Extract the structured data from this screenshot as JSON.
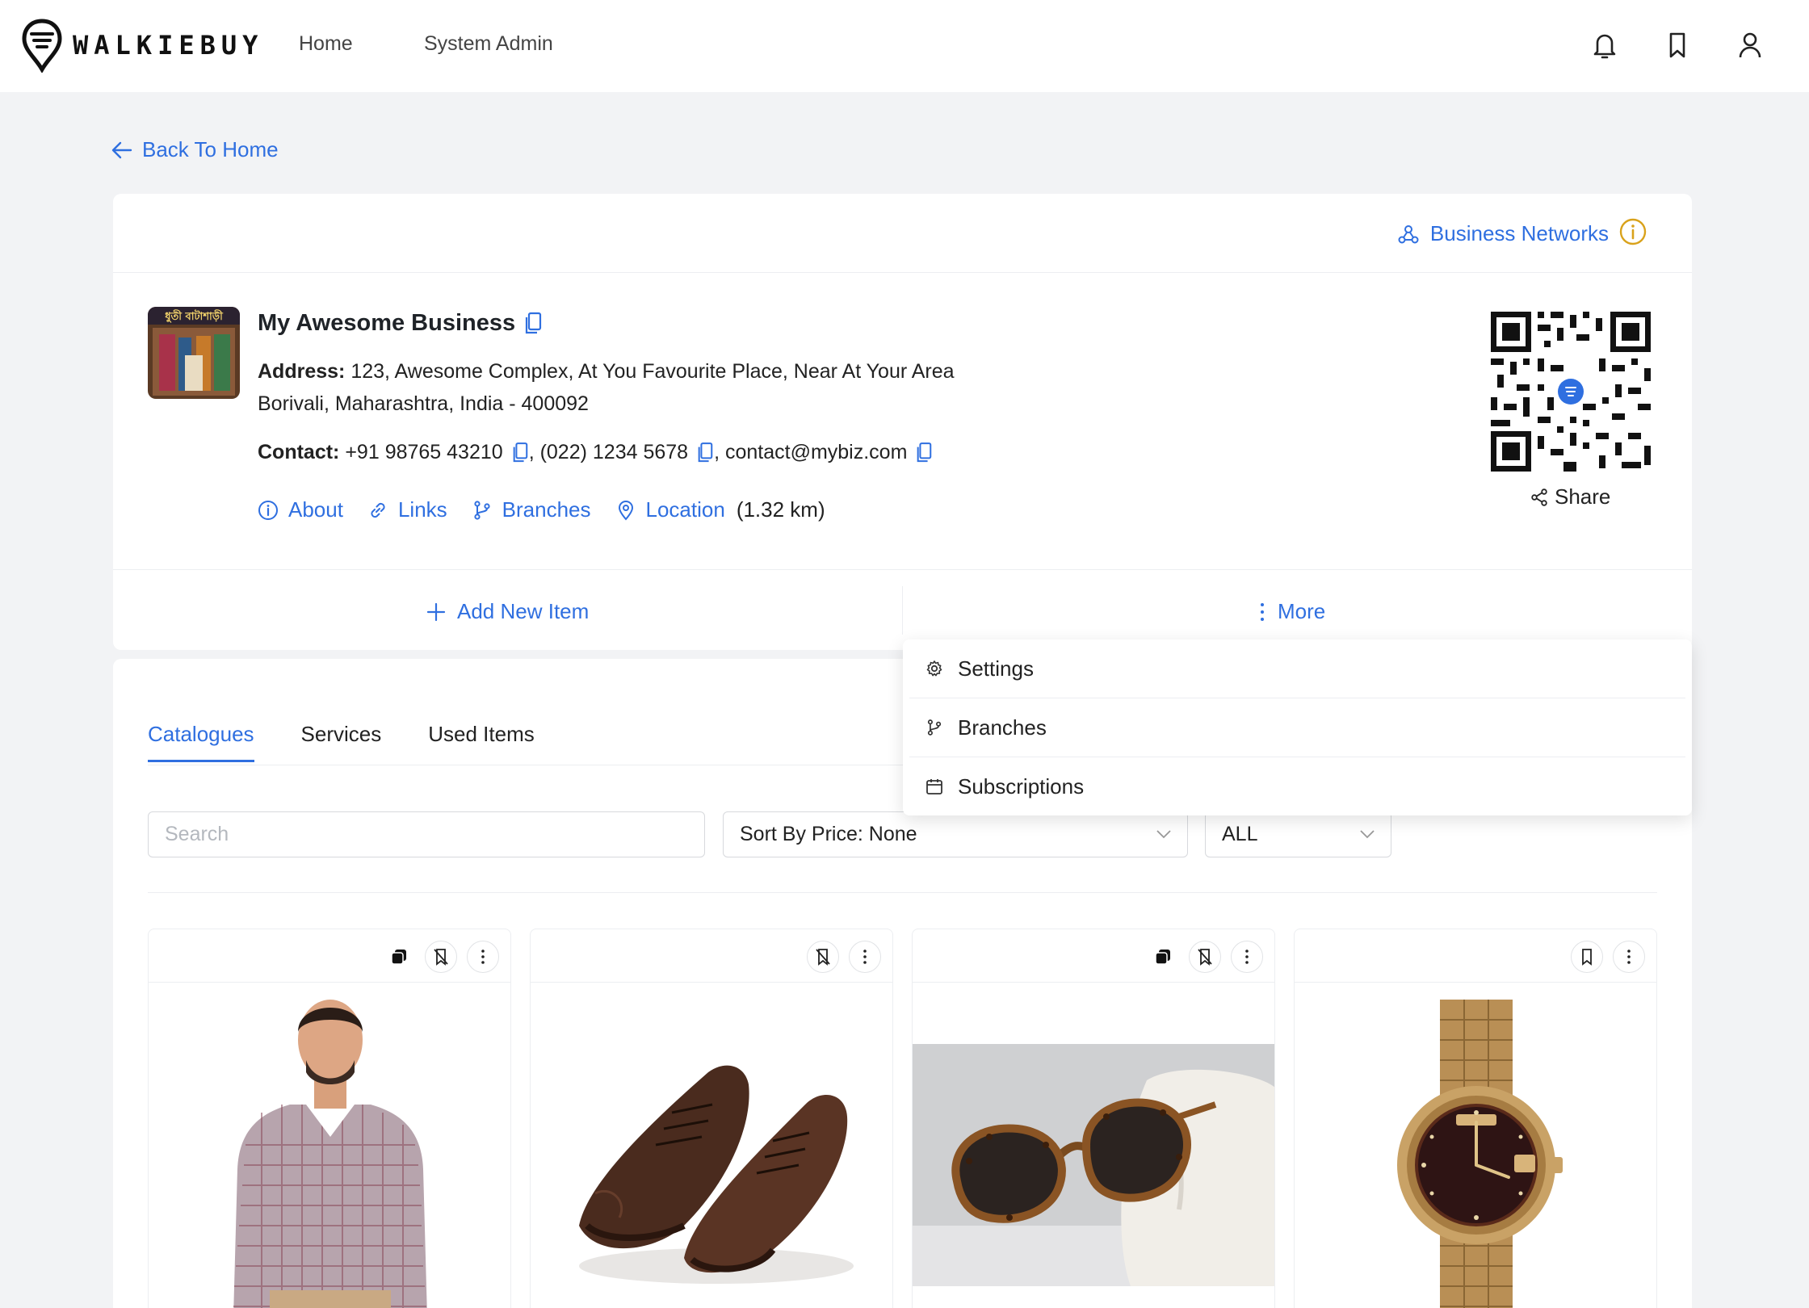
{
  "brand": {
    "name": "WALKIEBUY"
  },
  "nav": {
    "home": "Home",
    "system_admin": "System Admin"
  },
  "top_icons": [
    "bell-icon",
    "bookmark-icon",
    "user-icon"
  ],
  "back_link": "Back To Home",
  "business": {
    "networks_link": "Business Networks",
    "name": "My Awesome Business",
    "address_label": "Address:",
    "address_line1": " 123, Awesome Complex, At You Favourite Place, Near At Your Area",
    "address_line2": "Borivali, Maharashtra, India - 400092",
    "contact_label": "Contact:",
    "phone1": " +91 98765 43210",
    "phone2": ", (022) 1234 5678",
    "email": ", contact@mybiz.com",
    "links": {
      "about": "About",
      "links": "Links",
      "branches": "Branches",
      "location": "Location",
      "distance": "(1.32 km)"
    },
    "share": "Share"
  },
  "actions": {
    "add_item": "Add New Item",
    "more": "More"
  },
  "more_menu": {
    "items": [
      {
        "label": "Settings",
        "icon": "gear-icon"
      },
      {
        "label": "Branches",
        "icon": "branch-icon"
      },
      {
        "label": "Subscriptions",
        "icon": "calendar-icon"
      }
    ]
  },
  "tabs": [
    "Catalogues",
    "Services",
    "Used Items"
  ],
  "active_tab": "Catalogues",
  "filters": {
    "search_placeholder": "Search",
    "sort": "Sort By Price: None",
    "category": "ALL"
  },
  "products": [
    {
      "image": "man-in-checked-shirt",
      "buttons": [
        "copy-icon",
        "bookmark-off-icon",
        "kebab-menu-icon"
      ]
    },
    {
      "image": "brown-leather-shoes",
      "buttons": [
        "bookmark-off-icon",
        "kebab-menu-icon"
      ]
    },
    {
      "image": "tortoiseshell-sunglasses",
      "buttons": [
        "copy-icon",
        "bookmark-off-icon",
        "kebab-menu-icon"
      ]
    },
    {
      "image": "gold-wristwatch",
      "buttons": [
        "bookmark-icon",
        "kebab-menu-icon"
      ]
    }
  ],
  "colors": {
    "accent": "#2f6fe0",
    "info": "#d9a21b",
    "background": "#f2f3f5"
  }
}
